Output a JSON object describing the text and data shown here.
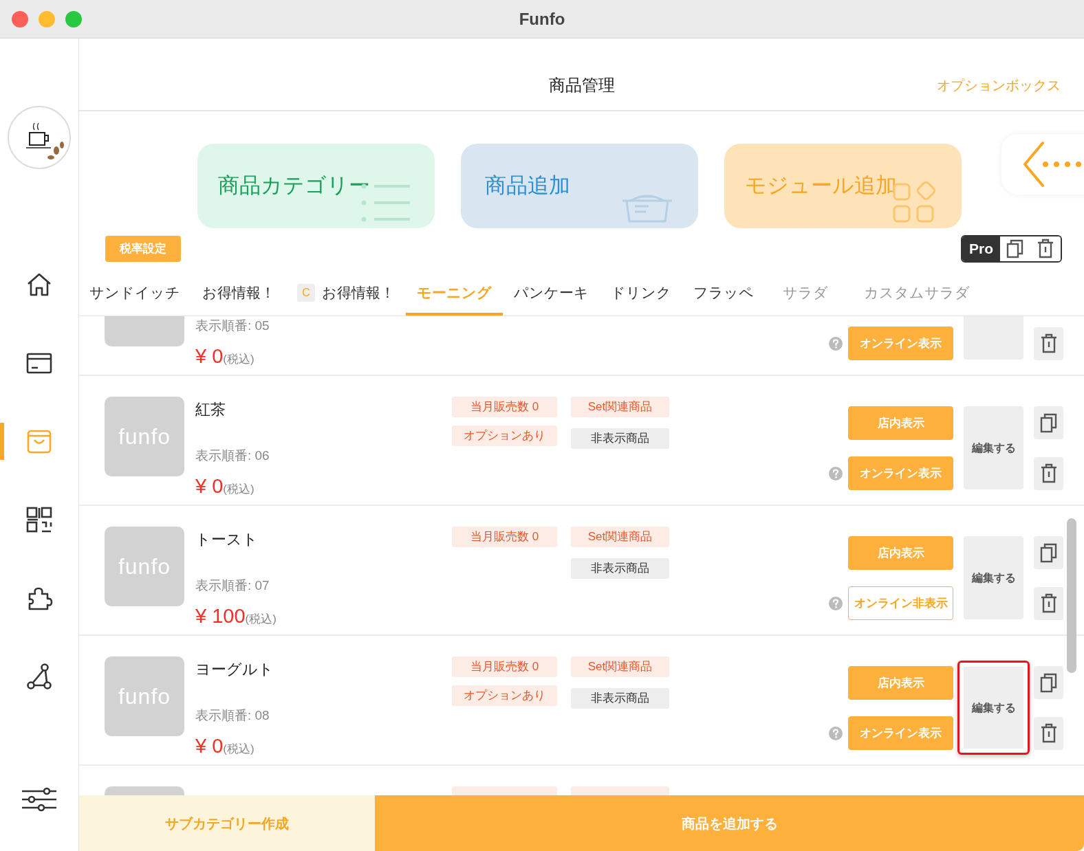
{
  "window": {
    "title": "Funfo"
  },
  "sidebar": {
    "items": [
      {
        "kind": "home",
        "selected": false
      },
      {
        "kind": "card",
        "selected": false
      },
      {
        "kind": "bag",
        "selected": true
      },
      {
        "kind": "qr",
        "selected": false
      },
      {
        "kind": "puzzle",
        "selected": false
      },
      {
        "kind": "share",
        "selected": false
      },
      {
        "kind": "settings",
        "selected": false
      }
    ]
  },
  "header": {
    "title": "商品管理",
    "link": "オプションボックス"
  },
  "shortcuts": [
    {
      "kind": "category",
      "label": "商品カテゴリー"
    },
    {
      "kind": "add",
      "label": "商品追加"
    },
    {
      "kind": "module",
      "label": "モジュール追加"
    },
    {
      "kind": "back"
    }
  ],
  "tax_button": "税率設定",
  "toolbar": {
    "pro": "Pro"
  },
  "tabs": [
    {
      "label": "サンドイッチ",
      "selected": false,
      "disabled": false
    },
    {
      "label": "お得情報！",
      "selected": false,
      "disabled": false
    },
    {
      "label": "お得情報！",
      "badge": "C",
      "selected": false,
      "disabled": false
    },
    {
      "label": "モーニング",
      "selected": true,
      "disabled": false
    },
    {
      "label": "パンケーキ",
      "selected": false,
      "disabled": false
    },
    {
      "label": "ドリンク",
      "selected": false,
      "disabled": false
    },
    {
      "label": "フラッペ",
      "selected": false,
      "disabled": false
    },
    {
      "label": "サラダ",
      "selected": false,
      "disabled": true
    },
    {
      "label": "カスタムサラダ",
      "selected": false,
      "disabled": true
    }
  ],
  "products": [
    {
      "order": "表示順番: 05",
      "price": "¥ 0",
      "tax": "(税込)",
      "online": {
        "label": "オンライン表示",
        "on": true
      },
      "highlighted": false
    },
    {
      "thumb": "funfo",
      "name": "紅茶",
      "order": "表示順番: 06",
      "price": "¥ 0",
      "tax": "(税込)",
      "tags": [
        {
          "kind": "sales",
          "label": "当月販売数 0"
        },
        {
          "kind": "set",
          "label": "Set関連商品"
        },
        {
          "kind": "option",
          "label": "オプションあり"
        },
        {
          "kind": "hidden",
          "label": "非表示商品"
        }
      ],
      "store": {
        "label": "店内表示",
        "on": true
      },
      "online": {
        "label": "オンライン表示",
        "on": true
      },
      "edit": "編集する",
      "highlighted": false
    },
    {
      "thumb": "funfo",
      "name": "トースト",
      "order": "表示順番: 07",
      "price": "¥ 100",
      "tax": "(税込)",
      "tags": [
        {
          "kind": "sales",
          "label": "当月販売数 0"
        },
        {
          "kind": "set",
          "label": "Set関連商品"
        },
        {
          "kind": "hidden",
          "label": "非表示商品"
        }
      ],
      "store": {
        "label": "店内表示",
        "on": true
      },
      "online": {
        "label": "オンライン非表示",
        "on": false
      },
      "edit": "編集する",
      "highlighted": false
    },
    {
      "thumb": "funfo",
      "name": "ヨーグルト",
      "order": "表示順番: 08",
      "price": "¥ 0",
      "tax": "(税込)",
      "tags": [
        {
          "kind": "sales",
          "label": "当月販売数 0"
        },
        {
          "kind": "set",
          "label": "Set関連商品"
        },
        {
          "kind": "option",
          "label": "オプションあり"
        },
        {
          "kind": "hidden",
          "label": "非表示商品"
        }
      ],
      "store": {
        "label": "店内表示",
        "on": true
      },
      "online": {
        "label": "オンライン表示",
        "on": true
      },
      "edit": "編集する",
      "highlighted": true
    },
    {
      "tags": [
        {
          "kind": "sales"
        },
        {
          "kind": "set"
        }
      ]
    }
  ],
  "footer": {
    "subcategory": "サブカテゴリー作成",
    "add": "商品を追加する"
  }
}
